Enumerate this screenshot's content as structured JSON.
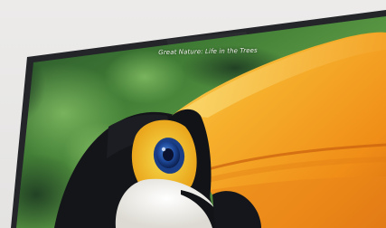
{
  "caption": {
    "text": "Great Nature: Life in the Trees"
  },
  "colors": {
    "wall": "#e9e8e7",
    "bezel": "#25272b",
    "beak_orange": "#f39a1d",
    "beak_yellow": "#f6c83b",
    "feathers_black": "#15161a",
    "throat_white": "#f3f2ee",
    "eye_blue": "#1f4fa0",
    "foliage_green": "#3c7a33"
  },
  "icons": [
    "toucan-image",
    "webcam-notch"
  ]
}
